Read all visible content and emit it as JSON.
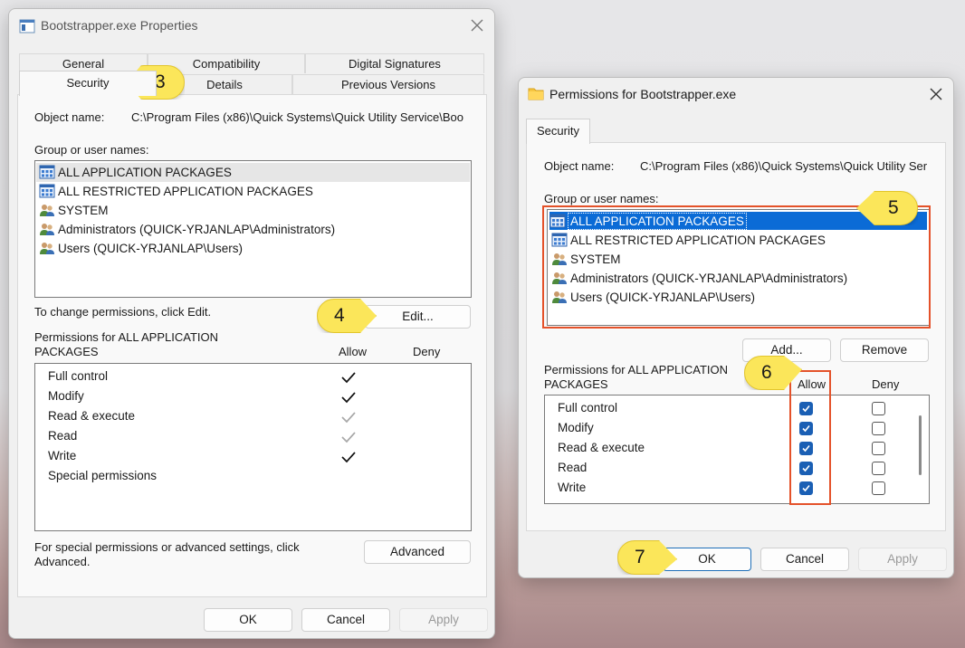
{
  "props": {
    "title": "Bootstrapper.exe Properties",
    "tabs_row1": [
      "General",
      "Compatibility",
      "Digital Signatures"
    ],
    "tabs_row2": [
      "Security",
      "Details",
      "Previous Versions"
    ],
    "object_name_label": "Object name:",
    "object_name_value": "C:\\Program Files (x86)\\Quick Systems\\Quick Utility Service\\Boo",
    "group_label": "Group or user names:",
    "groups": [
      {
        "name": "ALL APPLICATION PACKAGES",
        "icon": "app-package-icon"
      },
      {
        "name": "ALL RESTRICTED APPLICATION PACKAGES",
        "icon": "app-package-icon"
      },
      {
        "name": "SYSTEM",
        "icon": "users-group-icon"
      },
      {
        "name": "Administrators (QUICK-YRJANLAP\\Administrators)",
        "icon": "users-group-icon"
      },
      {
        "name": "Users (QUICK-YRJANLAP\\Users)",
        "icon": "users-group-icon"
      }
    ],
    "change_text": "To change permissions, click Edit.",
    "edit_button": "Edit...",
    "perms_label_1": "Permissions for ALL APPLICATION",
    "perms_label_2": "PACKAGES",
    "allow_header": "Allow",
    "deny_header": "Deny",
    "permissions": [
      {
        "name": "Full control",
        "allow": "checked"
      },
      {
        "name": "Modify",
        "allow": "checked"
      },
      {
        "name": "Read & execute",
        "allow": "inherited"
      },
      {
        "name": "Read",
        "allow": "inherited"
      },
      {
        "name": "Write",
        "allow": "checked"
      },
      {
        "name": "Special permissions",
        "allow": "none"
      }
    ],
    "special_text_1": "For special permissions or advanced settings, click",
    "special_text_2": "Advanced.",
    "advanced_button": "Advanced",
    "ok_button": "OK",
    "cancel_button": "Cancel",
    "apply_button": "Apply"
  },
  "perm_dialog": {
    "title": "Permissions for Bootstrapper.exe",
    "tab": "Security",
    "object_name_label": "Object name:",
    "object_name_value": "C:\\Program Files (x86)\\Quick Systems\\Quick Utility Ser",
    "group_label": "Group or user names:",
    "groups": [
      {
        "name": "ALL APPLICATION PACKAGES",
        "icon": "app-package-icon",
        "selected": true
      },
      {
        "name": "ALL RESTRICTED APPLICATION PACKAGES",
        "icon": "app-package-icon",
        "selected": false
      },
      {
        "name": "SYSTEM",
        "icon": "users-group-icon",
        "selected": false
      },
      {
        "name": "Administrators (QUICK-YRJANLAP\\Administrators)",
        "icon": "users-group-icon",
        "selected": false
      },
      {
        "name": "Users (QUICK-YRJANLAP\\Users)",
        "icon": "users-group-icon",
        "selected": false
      }
    ],
    "add_button": "Add...",
    "remove_button": "Remove",
    "perms_label_1": "Permissions for ALL APPLICATION",
    "perms_label_2": "PACKAGES",
    "allow_header": "Allow",
    "deny_header": "Deny",
    "permissions": [
      {
        "name": "Full control",
        "allow": true,
        "deny": false
      },
      {
        "name": "Modify",
        "allow": true,
        "deny": false
      },
      {
        "name": "Read & execute",
        "allow": true,
        "deny": false
      },
      {
        "name": "Read",
        "allow": true,
        "deny": false
      },
      {
        "name": "Write",
        "allow": true,
        "deny": false
      }
    ],
    "ok_button": "OK",
    "cancel_button": "Cancel",
    "apply_button": "Apply"
  },
  "callouts": [
    "3",
    "4",
    "5",
    "6",
    "7"
  ],
  "colors": {
    "callout": "#fbe65a",
    "highlight_box": "#e4522a",
    "selection": "#0b6bd6",
    "checkbox": "#1a5fb4"
  }
}
